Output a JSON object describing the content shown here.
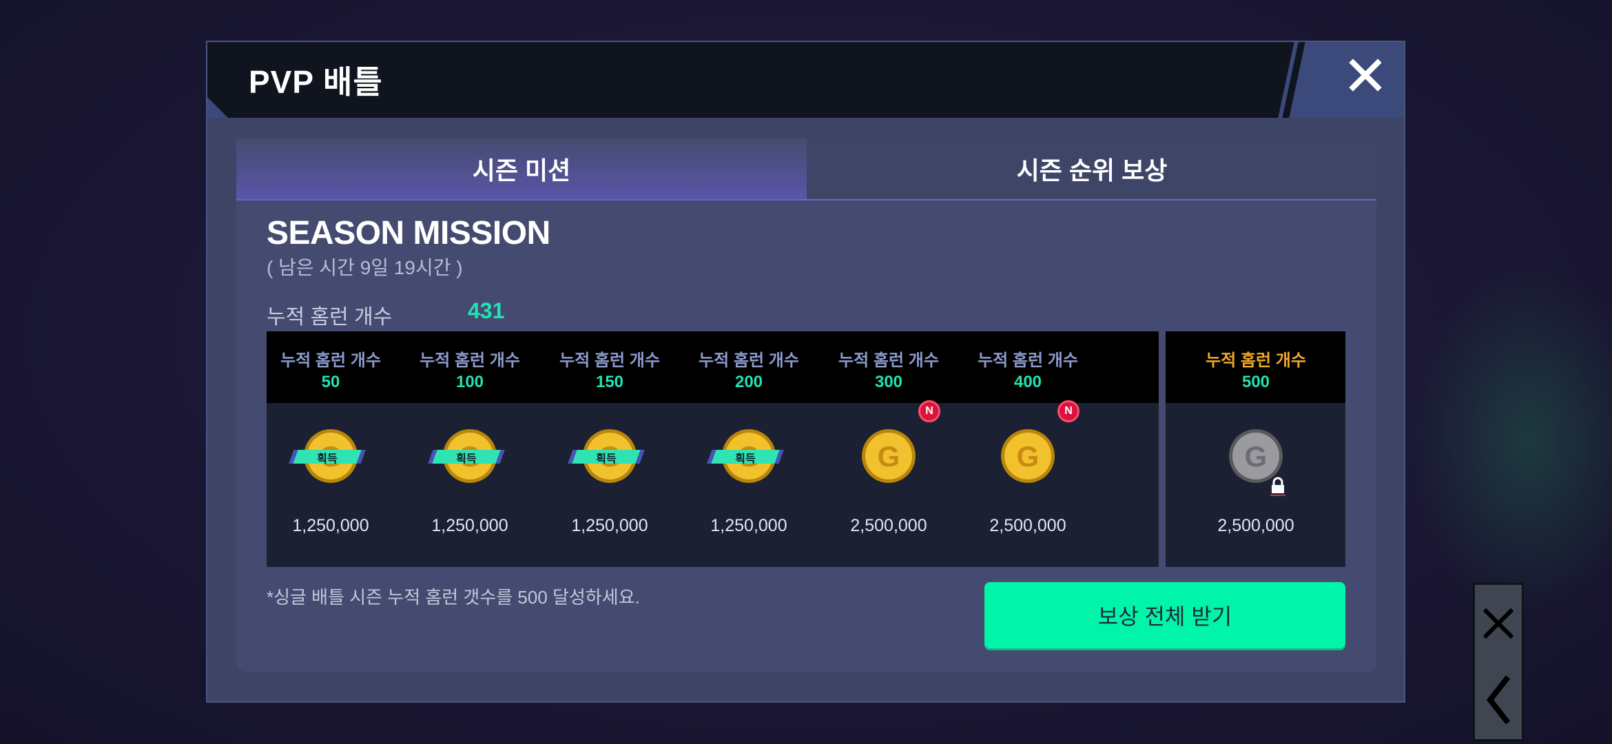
{
  "dialog": {
    "title": "PVP 배틀",
    "close_icon": "close-icon"
  },
  "tabs": [
    {
      "label": "시즌 미션",
      "active": true
    },
    {
      "label": "시즌 순위 보상",
      "active": false
    }
  ],
  "season": {
    "title": "SEASON MISSION",
    "remaining": "( 남은 시간 9일 19시간 )",
    "count_label": "누적 홈런 개수",
    "count_value": "431"
  },
  "missions": [
    {
      "label": "누적 홈런 개수",
      "target": "50",
      "amount": "1,250,000",
      "status": "획득",
      "icon": "gold-coin-icon"
    },
    {
      "label": "누적 홈런 개수",
      "target": "100",
      "amount": "1,250,000",
      "status": "획득",
      "icon": "gold-coin-icon"
    },
    {
      "label": "누적 홈런 개수",
      "target": "150",
      "amount": "1,250,000",
      "status": "획득",
      "icon": "gold-coin-icon"
    },
    {
      "label": "누적 홈런 개수",
      "target": "200",
      "amount": "1,250,000",
      "status": "획득",
      "icon": "gold-coin-icon"
    },
    {
      "label": "누적 홈런 개수",
      "target": "300",
      "amount": "2,500,000",
      "badge": "N",
      "icon": "gold-coin-icon"
    },
    {
      "label": "누적 홈런 개수",
      "target": "400",
      "amount": "2,500,000",
      "badge": "N",
      "icon": "gold-coin-icon"
    }
  ],
  "final_mission": {
    "label": "누적 홈런 개수",
    "target": "500",
    "amount": "2,500,000",
    "icon": "silver-coin-icon",
    "lock_icon": "lock-icon"
  },
  "notice": "*싱글 배틀 시즌 누적 홈런 갯수를 500 달성하세요.",
  "claim_button": "보상 전체 받기",
  "side_buttons": [
    "close-icon",
    "back-icon"
  ],
  "colors": {
    "accent": "#21e3b2",
    "button": "#00f5a8",
    "gold_label": "#f0a92a",
    "new_badge": "#d8143e"
  }
}
